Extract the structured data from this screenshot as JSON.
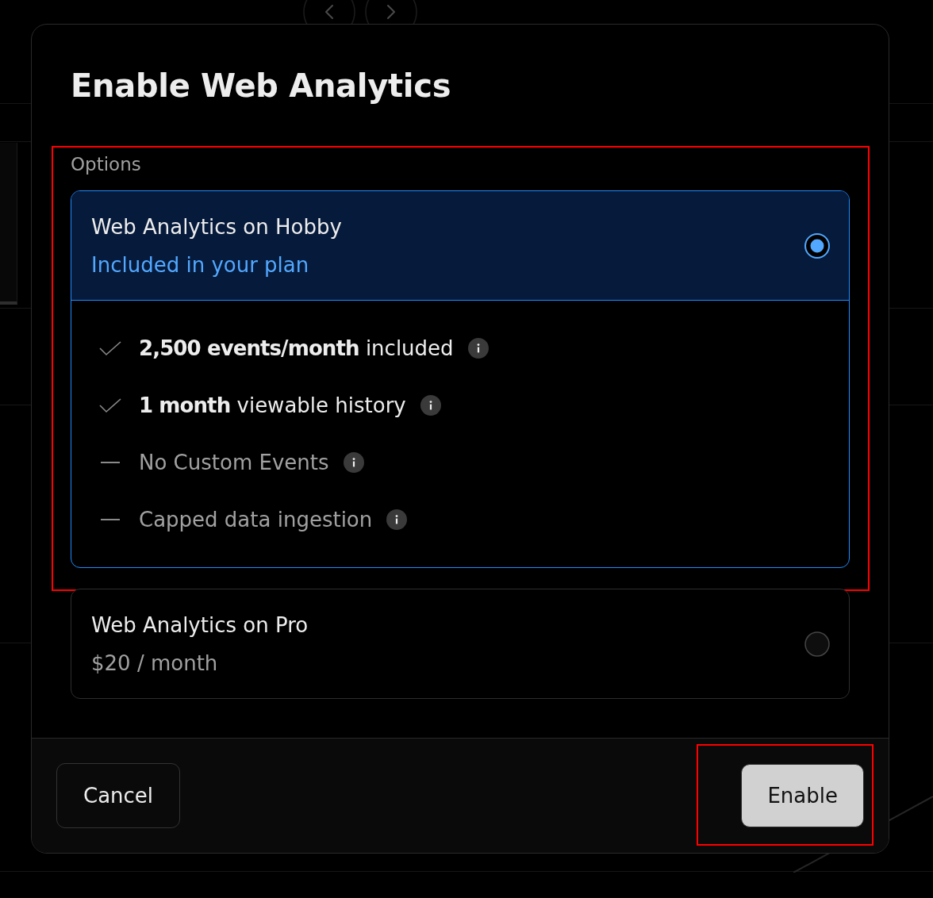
{
  "dialog": {
    "title": "Enable Web Analytics"
  },
  "options": {
    "label": "Options",
    "plans": [
      {
        "name": "Web Analytics on Hobby",
        "subtitle": "Included in your plan",
        "selected": true,
        "highlighted": true,
        "features": [
          {
            "text": "**2,500 events/month** included",
            "included": true
          },
          {
            "text": "**1 month** viewable history",
            "included": true
          },
          {
            "text": "No Custom Events",
            "included": false
          },
          {
            "text": "Capped data ingestion",
            "included": false
          }
        ]
      },
      {
        "name": "Web Analytics on Pro",
        "subtitle": "$20 / month",
        "selected": false,
        "highlighted": false
      }
    ]
  },
  "buttons": [
    {
      "label": "Cancel",
      "kind": "secondary",
      "highlighted": false
    },
    {
      "label": "Enable",
      "kind": "primary",
      "highlighted": true
    }
  ]
}
